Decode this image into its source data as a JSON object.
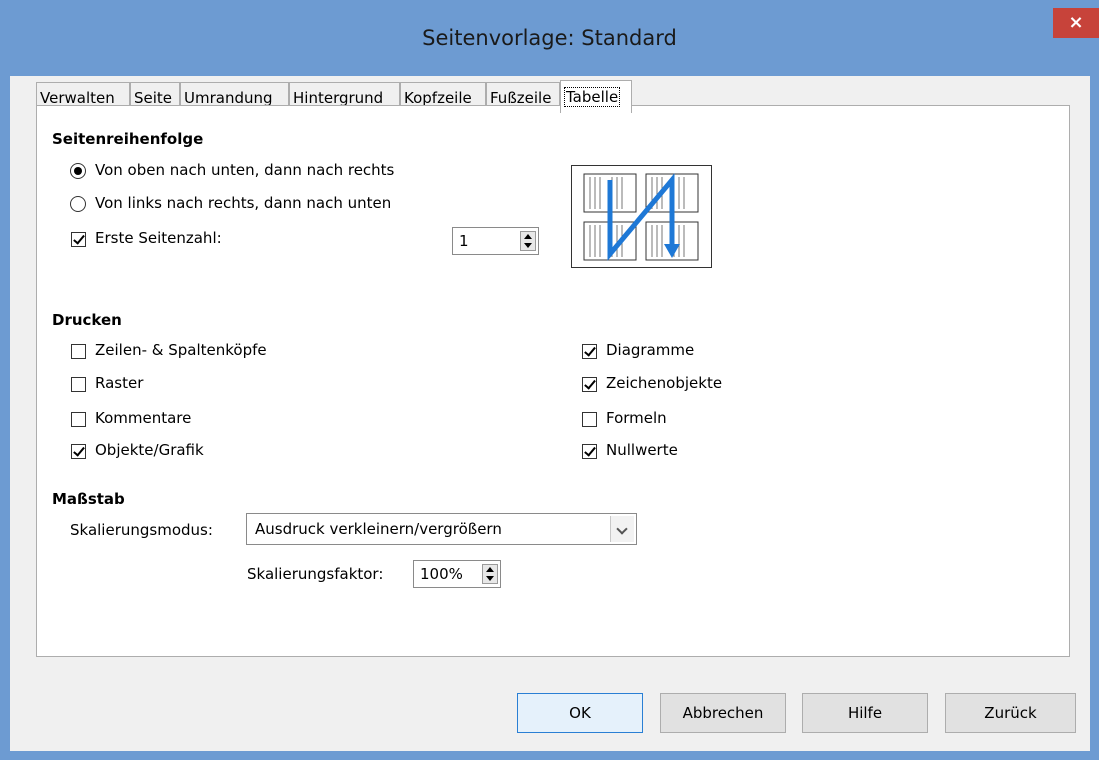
{
  "window": {
    "title": "Seitenvorlage: Standard",
    "close_label": "×"
  },
  "tabs": [
    {
      "label": "Verwalten"
    },
    {
      "label": "Seite"
    },
    {
      "label": "Umrandung"
    },
    {
      "label": "Hintergrund"
    },
    {
      "label": "Kopfzeile"
    },
    {
      "label": "Fußzeile"
    },
    {
      "label": "Tabelle",
      "active": true
    }
  ],
  "page_order": {
    "heading": "Seitenreihenfolge",
    "top_down": {
      "label": "Von oben nach unten, dann nach rechts",
      "checked": true
    },
    "left_right": {
      "label": "Von links nach rechts, dann nach unten",
      "checked": false
    },
    "first_page": {
      "label": "Erste Seitenzahl:",
      "checked": true,
      "value": "1"
    }
  },
  "print": {
    "heading": "Drucken",
    "headers": {
      "label": "Zeilen- & Spaltenköpfe",
      "checked": false
    },
    "grid": {
      "label": "Raster",
      "checked": false
    },
    "comments": {
      "label": "Kommentare",
      "checked": false
    },
    "objects": {
      "label": "Objekte/Grafik",
      "checked": true
    },
    "charts": {
      "label": "Diagramme",
      "checked": true
    },
    "drawings": {
      "label": "Zeichenobjekte",
      "checked": true
    },
    "formulas": {
      "label": "Formeln",
      "checked": false
    },
    "zeros": {
      "label": "Nullwerte",
      "checked": true
    }
  },
  "scale": {
    "heading": "Maßstab",
    "mode_label": "Skalierungsmodus:",
    "mode_value": "Ausdruck verkleinern/vergrößern",
    "factor_label": "Skalierungsfaktor:",
    "factor_value": "100%"
  },
  "buttons": {
    "ok": "OK",
    "cancel": "Abbrechen",
    "help": "Hilfe",
    "reset": "Zurück"
  },
  "colors": {
    "titlebar": "#6d9bd2",
    "close": "#c7433a",
    "preview_arrow": "#1e78d6"
  }
}
